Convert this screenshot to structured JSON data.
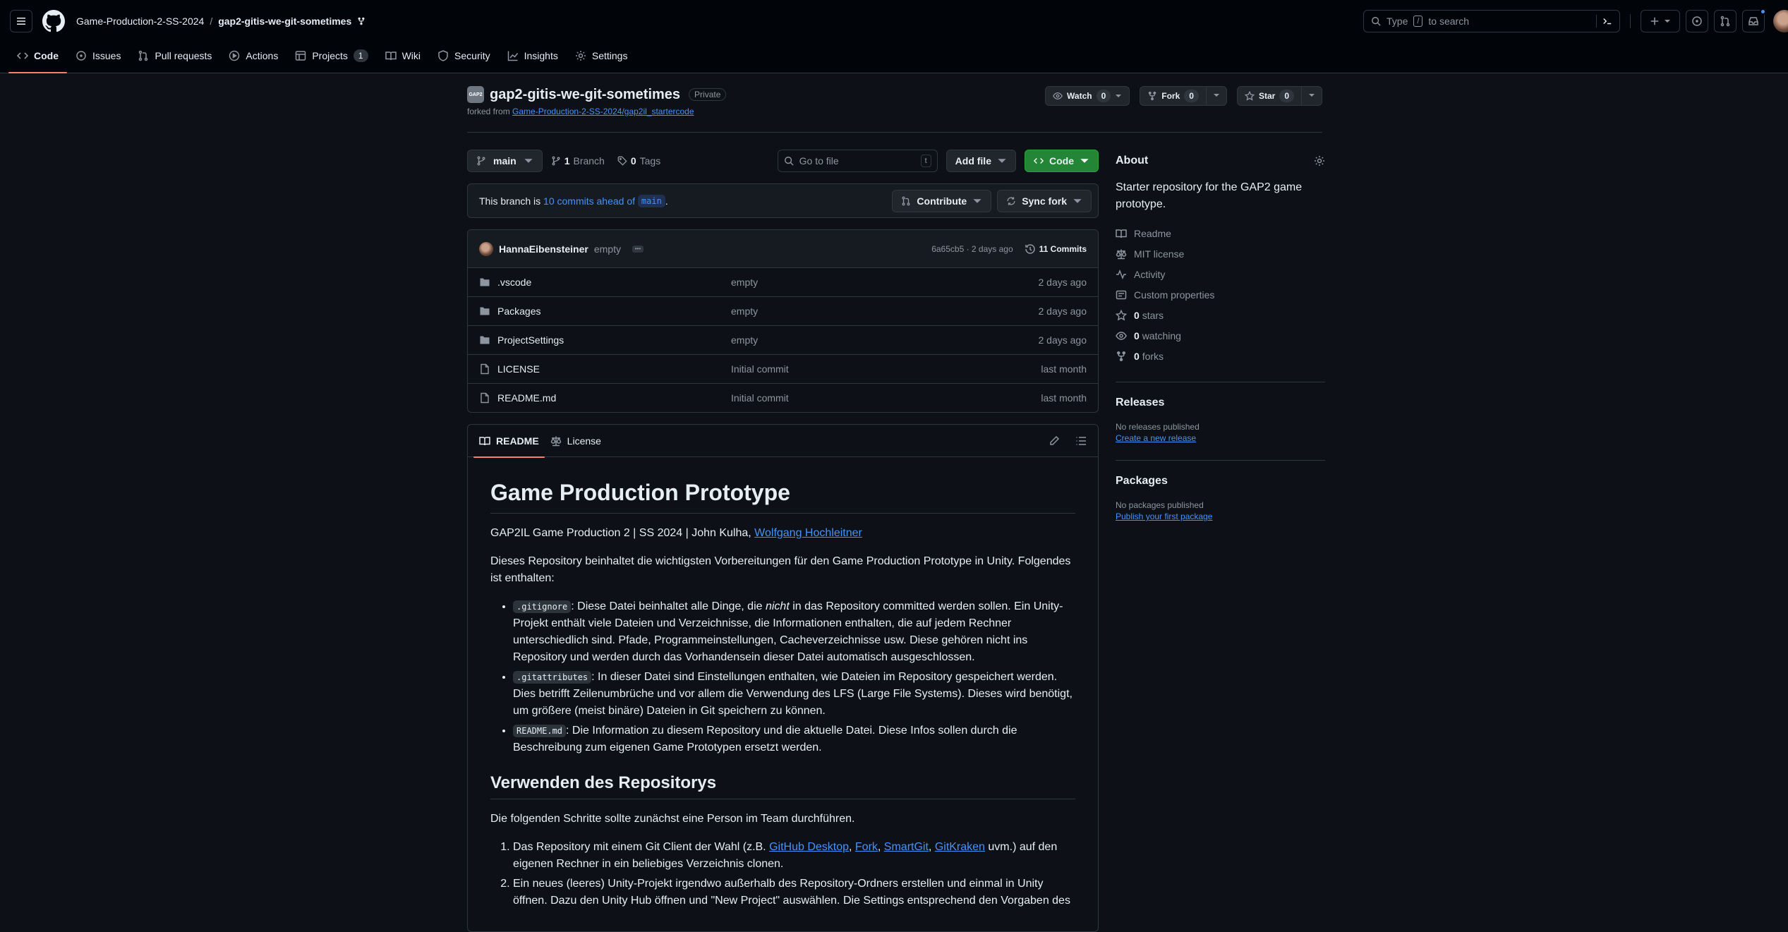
{
  "header": {
    "owner": "Game-Production-2-SS-2024",
    "separator": "/",
    "repo": "gap2-gitis-we-git-sometimes",
    "search_placeholder_prefix": "Type",
    "search_key": "/",
    "search_placeholder_suffix": "to search"
  },
  "nav": {
    "tabs": [
      {
        "label": "Code"
      },
      {
        "label": "Issues"
      },
      {
        "label": "Pull requests"
      },
      {
        "label": "Actions"
      },
      {
        "label": "Projects",
        "count": "1"
      },
      {
        "label": "Wiki"
      },
      {
        "label": "Security"
      },
      {
        "label": "Insights"
      },
      {
        "label": "Settings"
      }
    ]
  },
  "repo": {
    "avatar_text": "GAP2",
    "name": "gap2-gitis-we-git-sometimes",
    "visibility": "Private",
    "forked_from_label": "forked from",
    "forked_from": "Game-Production-2-SS-2024/gap2il_startercode",
    "watch_label": "Watch",
    "watch_count": "0",
    "fork_label": "Fork",
    "fork_count": "0",
    "star_label": "Star",
    "star_count": "0"
  },
  "toolbar": {
    "branch": "main",
    "branches_count": "1",
    "branches_label": "Branch",
    "tags_count": "0",
    "tags_label": "Tags",
    "goto_placeholder": "Go to file",
    "goto_key": "t",
    "add_file": "Add file",
    "code": "Code"
  },
  "ahead": {
    "prefix": "This branch is",
    "link": "10 commits ahead of",
    "branch": "main",
    "suffix": ".",
    "contribute": "Contribute",
    "sync": "Sync fork"
  },
  "commit": {
    "author": "HannaEibensteiner",
    "message": "empty",
    "hash": "6a65cb5",
    "time": "2 days ago",
    "commits": "11 Commits"
  },
  "files": [
    {
      "name": ".vscode",
      "type": "folder",
      "message": "empty",
      "time": "2 days ago"
    },
    {
      "name": "Packages",
      "type": "folder",
      "message": "empty",
      "time": "2 days ago"
    },
    {
      "name": "ProjectSettings",
      "type": "folder",
      "message": "empty",
      "time": "2 days ago"
    },
    {
      "name": "LICENSE",
      "type": "file",
      "message": "Initial commit",
      "time": "last month"
    },
    {
      "name": "README.md",
      "type": "file",
      "message": "Initial commit",
      "time": "last month"
    }
  ],
  "readme": {
    "tab_readme": "README",
    "tab_license": "License",
    "h1": "Game Production Prototype",
    "byline": "GAP2IL Game Production 2 | SS 2024 | John Kulha, ",
    "byline_link": "Wolfgang Hochleitner",
    "intro": "Dieses Repository beinhaltet die wichtigsten Vorbereitungen für den Game Production Prototype in Unity. Folgendes ist enthalten:",
    "li1_code": ".gitignore",
    "li1_a": ": Diese Datei beinhaltet alle Dinge, die ",
    "li1_em": "nicht",
    "li1_b": " in das Repository committed werden sollen. Ein Unity-Projekt enthält viele Dateien und Verzeichnisse, die Informationen enthalten, die auf jedem Rechner unterschiedlich sind. Pfade, Programmeinstellungen, Cacheverzeichnisse usw. Diese gehören nicht ins Repository und werden durch das Vorhandensein dieser Datei automatisch ausgeschlossen.",
    "li2_code": ".gitattributes",
    "li2": ": In dieser Datei sind Einstellungen enthalten, wie Dateien im Repository gespeichert werden. Dies betrifft Zeilenumbrüche und vor allem die Verwendung des LFS (Large File Systems). Dieses wird benötigt, um größere (meist binäre) Dateien in Git speichern zu können.",
    "li3_code": "README.md",
    "li3": ": Die Information zu diesem Repository und die aktuelle Datei. Diese Infos sollen durch die Beschreibung zum eigenen Game Prototypen ersetzt werden.",
    "h2": "Verwenden des Repositorys",
    "steps_intro": "Die folgenden Schritte sollte zunächst eine Person im Team durchführen.",
    "step1_a": "Das Repository mit einem Git Client der Wahl (z.B. ",
    "step1_l1": "GitHub Desktop",
    "step1_sep1": ", ",
    "step1_l2": "Fork",
    "step1_sep2": ", ",
    "step1_l3": "SmartGit",
    "step1_sep3": ", ",
    "step1_l4": "GitKraken",
    "step1_b": " uvm.) auf den eigenen Rechner in ein beliebiges Verzeichnis clonen.",
    "step2": "Ein neues (leeres) Unity-Projekt irgendwo außerhalb des Repository-Ordners erstellen und einmal in Unity öffnen. Dazu den Unity Hub öffnen und \"New Project\" auswählen. Die Settings entsprechend den Vorgaben des"
  },
  "about": {
    "title": "About",
    "description": "Starter repository for the GAP2 game prototype.",
    "readme": "Readme",
    "license": "MIT license",
    "activity": "Activity",
    "custom": "Custom properties",
    "stars_n": "0",
    "stars": "stars",
    "watching_n": "0",
    "watching": "watching",
    "forks_n": "0",
    "forks": "forks"
  },
  "releases": {
    "title": "Releases",
    "none": "No releases published",
    "create": "Create a new release"
  },
  "packages": {
    "title": "Packages",
    "none": "No packages published",
    "publish": "Publish your first package"
  },
  "colors": {
    "accent": "#238636",
    "link": "#4493f8",
    "tab_underline": "#f78166"
  }
}
